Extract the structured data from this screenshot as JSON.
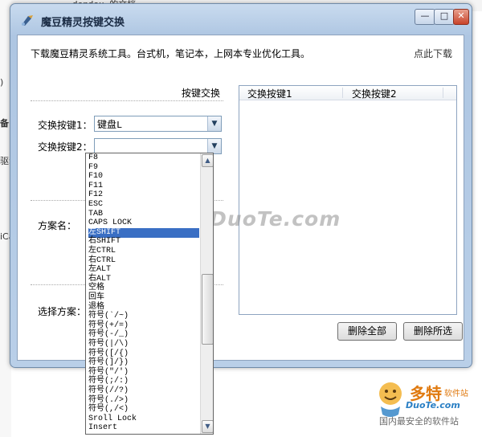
{
  "background": {
    "doc_title": "dendou 的文档",
    "left_fragments": [
      ")",
      "备",
      "驱动",
      "iCam"
    ]
  },
  "window": {
    "title": "魔豆精灵按键交换",
    "min_label": "—",
    "max_label": "□",
    "close_label": "✕"
  },
  "banner": {
    "text": "下载魔豆精灵系统工具。台式机，笔记本，上网本专业优化工具。",
    "link": "点此下载"
  },
  "section": {
    "label": "按键交换"
  },
  "form": {
    "key1_label": "交换按键1：",
    "key1_value": "键盘L",
    "key2_label": "交换按键2：",
    "key2_value": "",
    "scheme_name_label": "方案名：",
    "select_scheme_label": "选择方案："
  },
  "listview": {
    "columns": [
      "交换按键1",
      "交换按键2"
    ]
  },
  "buttons": {
    "delete_all": "删除全部",
    "delete_selected": "删除所选"
  },
  "dropdown": {
    "items": [
      "F8",
      "F9",
      "F10",
      "F11",
      "F12",
      "ESC",
      "TAB",
      "CAPS LOCK",
      "左SHIFT",
      "右SHIFT",
      "左CTRL",
      "右CTRL",
      "左ALT",
      "右ALT",
      "空格",
      "回车",
      "退格",
      "符号(`/~)",
      "符号(+/=)",
      "符号(-/_)",
      "符号(|/\\)",
      "符号([/{)",
      "符号(]/})",
      "符号(\"/')",
      "符号(;/:)",
      "符号(//?)",
      "符号(./>)",
      "符号(,/<)",
      "Sroll Lock",
      "Insert"
    ],
    "selected": "左SHIFT",
    "scroll_up": "▲",
    "scroll_down": "▼"
  },
  "watermark": {
    "center": "www.DuoTe.com",
    "brand": "多特",
    "brand_sub": "软件站",
    "site": "DuoTe.com",
    "tagline": "国内最安全的软件站"
  },
  "colors": {
    "selection": "#3a6fc4",
    "window_frame": "#aec6e2"
  }
}
